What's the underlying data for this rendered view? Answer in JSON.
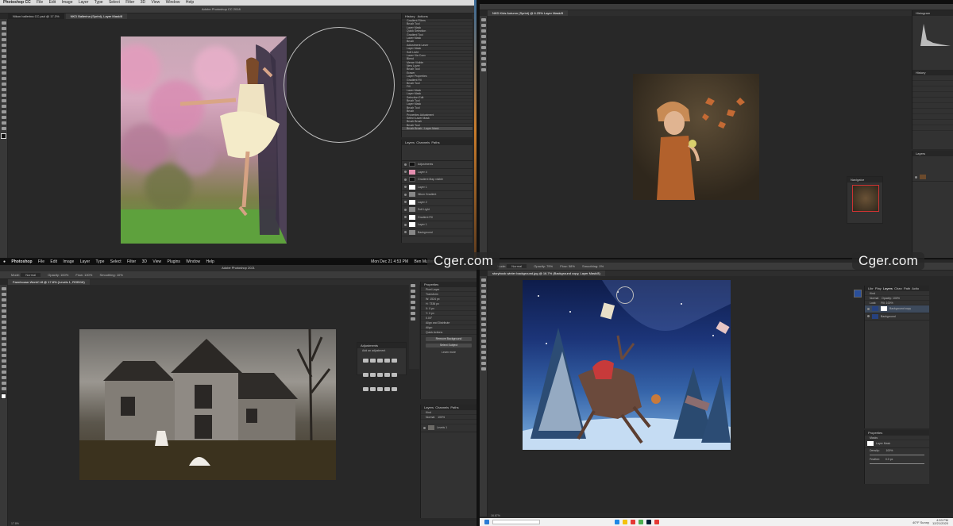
{
  "colors": {
    "ps_bg": "#282828",
    "panel": "#323232",
    "accent": "#2a7bd4"
  },
  "watermarks": {
    "top_left_quad": "Cger.com",
    "top_right_quad": "Cger.com"
  },
  "top_left": {
    "menu": [
      "Photoshop CC",
      "File",
      "Edit",
      "Image",
      "Layer",
      "Type",
      "Select",
      "Filter",
      "3D",
      "View",
      "Window",
      "Help"
    ],
    "title": "Adobe Photoshop CC 2018",
    "tabs": [
      "Nikon ballerina CC.psd @ 17.3%",
      "NKD Ballerina (Sprint), Layer Mask/8"
    ],
    "history": {
      "tabs": [
        "History",
        "Actions"
      ],
      "items": [
        "Gradient Filters",
        "Brush Tool",
        "Layer Mask",
        "Quick Selection",
        "Gradient Tool",
        "Layer Mask",
        "Brush",
        "Adjustment Layer",
        "Layer Mask",
        "Soft Light",
        "Layer Via Copy",
        "Blend",
        "Merge Visible",
        "New Layer",
        "Brush Tool",
        "Eraser",
        "Layer Properties",
        "Gradient Fill",
        "Brush Tool",
        "Fill",
        "Layer Mask",
        "Layer Mask",
        "Selection Edit",
        "Brush Tool",
        "Layer Mask",
        "Brush Tool",
        "Brush",
        "Properties Adjustment",
        "Select Layer Mask",
        "Brush Brush",
        "Brush Tool",
        "Brush Brush - Layer Mask"
      ]
    },
    "layers": {
      "tabs": [
        "Layers",
        "Channels",
        "Paths"
      ],
      "rows": [
        "Adjustments",
        "Layer 4",
        "Gradient Map visible",
        "Layer 1",
        "Nikon Gradient",
        "Layer 2",
        "Soft Light",
        "Gradient Fill",
        "Layer 1",
        "Background"
      ]
    }
  },
  "top_right": {
    "title": "NKD Kids Autumn (Sprint) @ 6.25% Layer Mask/8",
    "panels": [
      "Histogram",
      "History",
      "Layers"
    ],
    "navigator_title": "Navigator"
  },
  "bottom_left": {
    "menu": [
      "Photoshop",
      "File",
      "Edit",
      "Image",
      "Layer",
      "Type",
      "Select",
      "Filter",
      "3D",
      "View",
      "Plugins",
      "Window",
      "Help"
    ],
    "clock": "Mon Dec 21  4:53 PM",
    "user": "Ben Mutter",
    "title": "Adobe Photoshop 2021",
    "tab": "Farmhouse-WorkC.tif @ 17.8% (Levels 1, RGB/16)",
    "options": {
      "mode_label": "Mode:",
      "mode": "Normal",
      "opacity_label": "Opacity:",
      "opacity": "100%",
      "flow_label": "Flow:",
      "flow": "100%",
      "smooth_label": "Smoothing:",
      "smooth": "10%"
    },
    "adjustments": {
      "title": "Adjustments",
      "subtitle": "Add an adjustment"
    },
    "properties": {
      "tab": "Properties",
      "type": "Pixel Layer",
      "transform": "Transform",
      "w": "W: 1524 px",
      "h": "H: 7336 px",
      "x": "X: 0 px",
      "y": "Y: 0 px",
      "angle": "0.00°",
      "align": "Align and Distribute",
      "align_sub": "Align:",
      "quick": "Quick Actions",
      "remove_bg": "Remove Background",
      "select_subject": "Select Subject",
      "learn": "Learn more"
    },
    "layers": {
      "tabs": [
        "Layers",
        "Channels",
        "Paths"
      ],
      "kind": "Kind",
      "mode": "Normal",
      "opacity": "100%",
      "rows": [
        "Levels 1"
      ]
    },
    "status": "17.8%"
  },
  "bottom_right": {
    "tab": "storybook winter background.jpg @ 16.7% (Background copy, Layer Mask/8)",
    "options": {
      "mode_label": "Mode:",
      "mode": "Normal",
      "opacity_label": "Opacity:",
      "opacity": "79%",
      "flow_label": "Flow:",
      "flow": "58%",
      "smooth_label": "Smoothing:",
      "smooth": "0%"
    },
    "layers": {
      "tabs": [
        "Libr",
        "Play",
        "Layers",
        "Chan",
        "Path",
        "Actio"
      ],
      "kind": "Kind",
      "mode": "Normal",
      "opacity_label": "Opacity:",
      "opacity": "100%",
      "lock_label": "Lock:",
      "fill_label": "Fill:",
      "fill": "100%",
      "rows": [
        "Background copy",
        "Background"
      ]
    },
    "properties": {
      "tab": "Properties",
      "sub": "Masks",
      "mask": "Layer Mask",
      "density_label": "Density:",
      "density": "100%",
      "feather_label": "Feather:",
      "feather": "0.0 px"
    },
    "status": "16.67%",
    "taskbar": {
      "weather": "40°F  Sunny",
      "time": "4:53 PM",
      "date": "12/21/2020"
    }
  }
}
